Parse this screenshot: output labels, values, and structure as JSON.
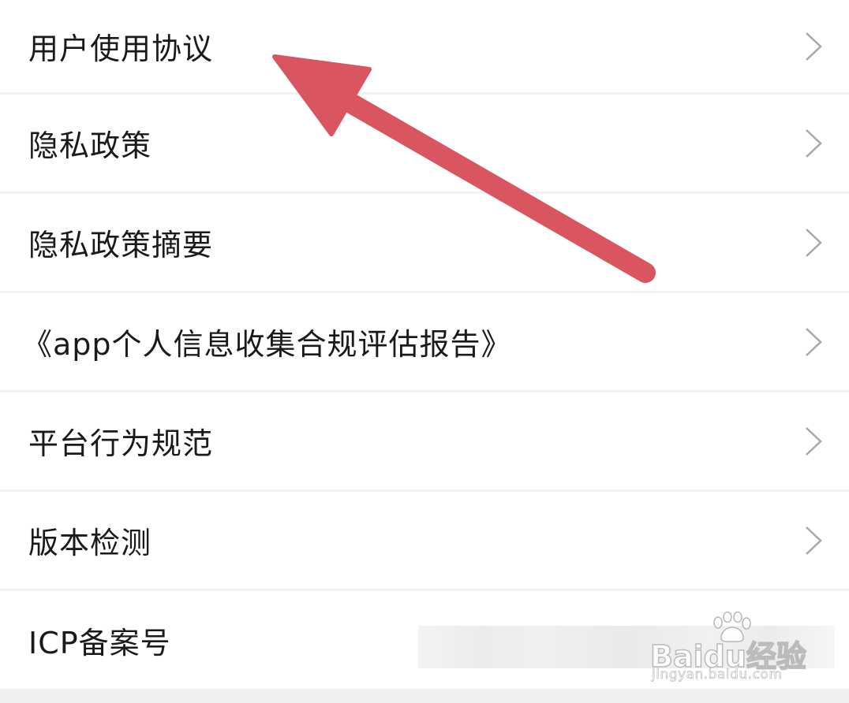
{
  "menu": {
    "items": [
      {
        "label": "用户使用协议",
        "chevron": "chevron-right-icon"
      },
      {
        "label": "隐私政策",
        "chevron": "chevron-right-icon"
      },
      {
        "label": "隐私政策摘要",
        "chevron": "chevron-right-icon"
      },
      {
        "label": "《app个人信息收集合规评估报告》",
        "chevron": "chevron-right-icon"
      },
      {
        "label": "平台行为规范",
        "chevron": "chevron-right-icon"
      },
      {
        "label": "版本检测",
        "chevron": "chevron-right-icon"
      },
      {
        "label": "ICP备案号",
        "value": ""
      }
    ]
  },
  "annotation": {
    "arrow_color": "#d9555f",
    "points_to": "用户使用协议"
  },
  "watermark": {
    "logo_text": "Baidu经验",
    "url": "jingyan.baidu.com"
  },
  "colors": {
    "background": "#f2f2f2",
    "row": "#ffffff",
    "text": "#1a1a1a",
    "chevron": "#a8a8a8"
  }
}
